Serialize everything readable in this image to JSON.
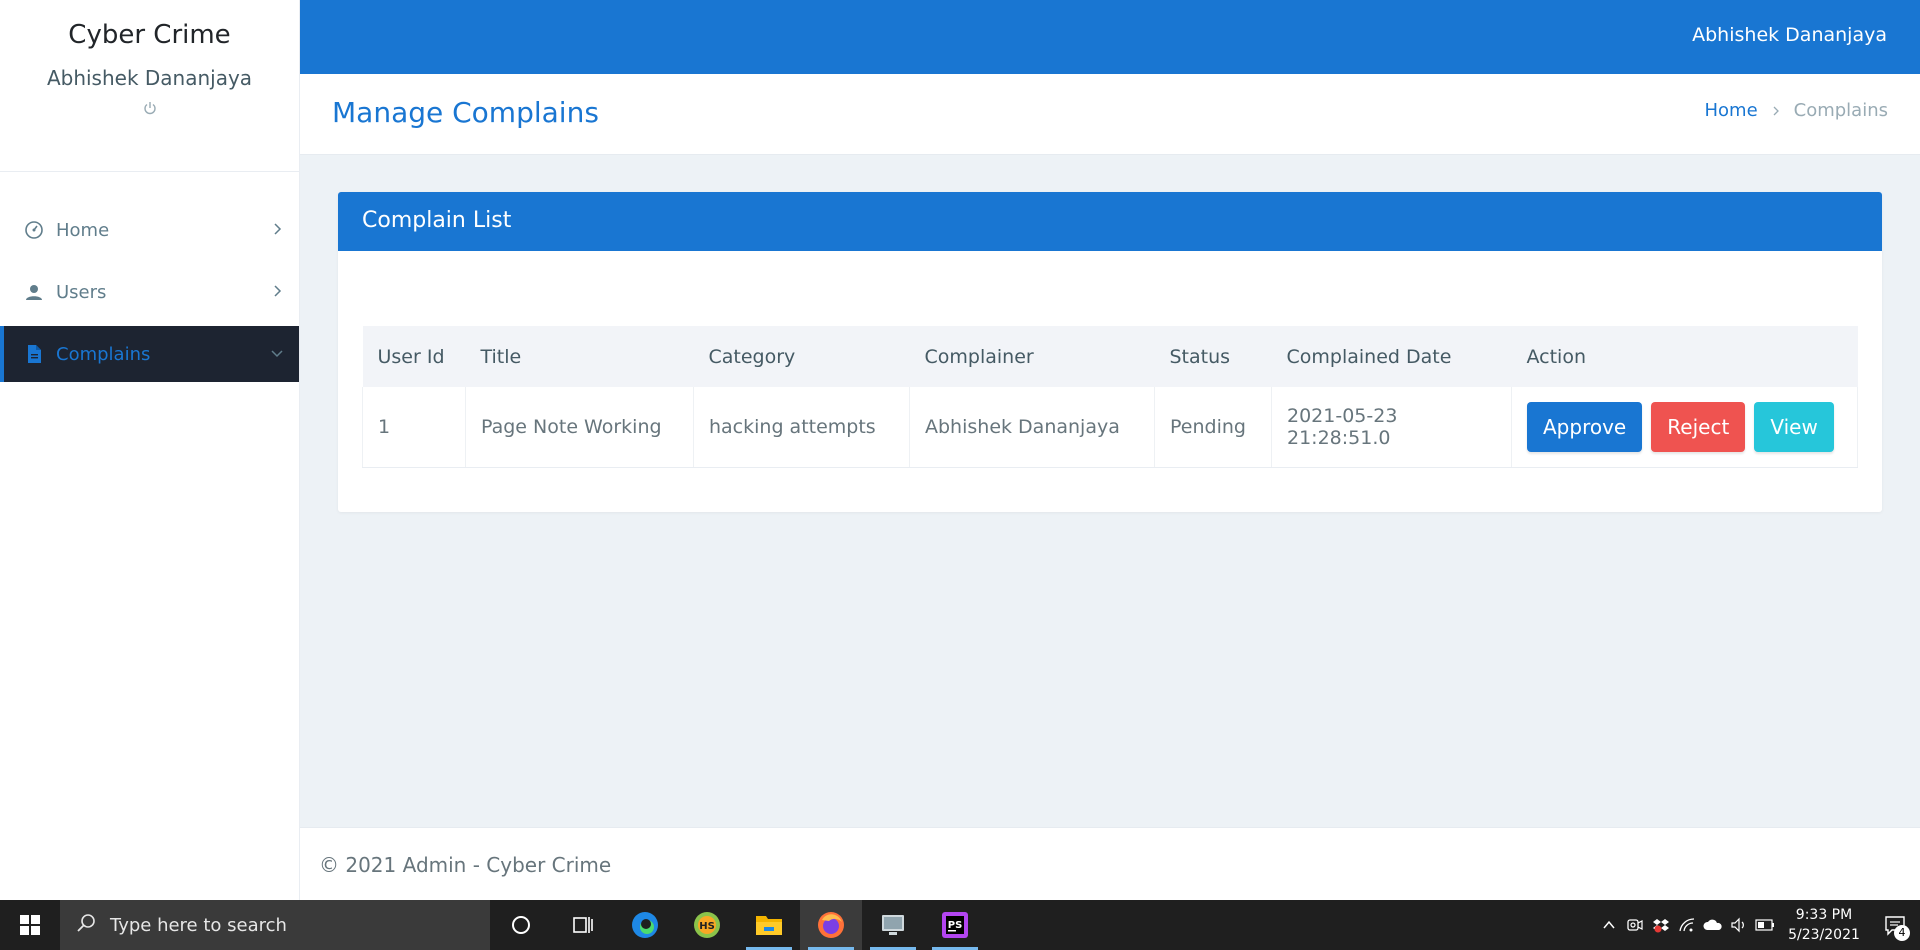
{
  "sidebar": {
    "brand": "Cyber Crime",
    "username": "Abhishek Dananjaya",
    "items": [
      {
        "label": "Home",
        "icon": "gauge-icon"
      },
      {
        "label": "Users",
        "icon": "user-icon"
      },
      {
        "label": "Complains",
        "icon": "document-icon",
        "active": true
      }
    ]
  },
  "topbar": {
    "username": "Abhishek Dananjaya"
  },
  "page": {
    "title": "Manage Complains",
    "breadcrumb": {
      "home": "Home",
      "current": "Complains"
    }
  },
  "card": {
    "title": "Complain List",
    "columns": [
      "User Id",
      "Title",
      "Category",
      "Complainer",
      "Status",
      "Complained Date",
      "Action"
    ],
    "rows": [
      {
        "user_id": "1",
        "title": "Page Note Working",
        "category": "hacking attempts",
        "complainer": "Abhishek Dananjaya",
        "status": "Pending",
        "date": "2021-05-23 21:28:51.0",
        "actions": {
          "approve": "Approve",
          "reject": "Reject",
          "view": "View"
        }
      }
    ]
  },
  "footer": {
    "text": "© 2021 Admin - Cyber Crime"
  },
  "taskbar": {
    "search_placeholder": "Type here to search",
    "time": "9:33 PM",
    "date": "5/23/2021",
    "notification_count": "4"
  },
  "colors": {
    "primary": "#1976d2",
    "danger": "#ef5350",
    "info": "#26c6da",
    "sidebar_active_bg": "#1d2431"
  }
}
